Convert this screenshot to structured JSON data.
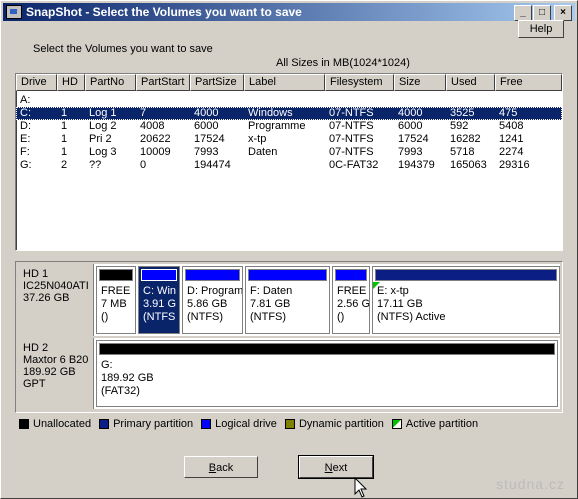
{
  "window": {
    "title": "SnapShot - Select the Volumes you want to save"
  },
  "toolbar": {
    "help_label": "Help"
  },
  "main": {
    "instruction": "Select the Volumes you want to save",
    "sizes_note": "All Sizes in MB(1024*1024)"
  },
  "table": {
    "columns": [
      "Drive",
      "HD",
      "PartNo",
      "PartStart",
      "PartSize",
      "Label",
      "Filesystem",
      "Size",
      "Used",
      "Free"
    ],
    "rows": [
      [
        "A:",
        "",
        "",
        "",
        "",
        "",
        "",
        "",
        "",
        ""
      ],
      [
        "C:",
        "1",
        "Log 1",
        "7",
        "4000",
        "Windows",
        "07-NTFS",
        "4000",
        "3525",
        "475"
      ],
      [
        "D:",
        "1",
        "Log 2",
        "4008",
        "6000",
        "Programme",
        "07-NTFS",
        "6000",
        "592",
        "5408"
      ],
      [
        "E:",
        "1",
        "Pri 2",
        "20622",
        "17524",
        "x-tp",
        "07-NTFS",
        "17524",
        "16282",
        "1241"
      ],
      [
        "F:",
        "1",
        "Log 3",
        "10009",
        "7993",
        "Daten",
        "07-NTFS",
        "7993",
        "5718",
        "2274"
      ],
      [
        "G:",
        "2",
        "??",
        "0",
        "194474",
        "",
        "0C-FAT32",
        "194379",
        "165063",
        "29316"
      ]
    ],
    "selected_row": 1
  },
  "disks": [
    {
      "info": [
        "HD 1",
        "IC25N040ATI",
        "37.26 GB"
      ],
      "partitions": [
        {
          "lines": [
            "FREE",
            "7 MB",
            "()"
          ],
          "bar": "#000000",
          "selected": false
        },
        {
          "lines": [
            "C: Win",
            "3.91 G",
            "(NTFS"
          ],
          "bar": "#0000ff",
          "selected": true
        },
        {
          "lines": [
            "D: Program",
            "5.86 GB",
            "(NTFS)"
          ],
          "bar": "#0000ff",
          "selected": false
        },
        {
          "lines": [
            "F: Daten",
            "7.81 GB",
            "(NTFS)"
          ],
          "bar": "#0000ff",
          "selected": false
        },
        {
          "lines": [
            "FREE",
            "2.56 G",
            "()"
          ],
          "bar": "#0000ff",
          "selected": false
        },
        {
          "lines": [
            "E: x-tp",
            "17.11 GB",
            "(NTFS) Active"
          ],
          "bar": "#0a1e84",
          "selected": false,
          "active": true
        }
      ]
    },
    {
      "info": [
        "HD 2",
        "Maxtor 6 B20",
        "189.92 GB",
        "GPT"
      ],
      "partitions": [
        {
          "lines": [
            "G:",
            "189.92 GB",
            "(FAT32)"
          ],
          "bar": "#000000",
          "selected": false
        }
      ]
    }
  ],
  "legend": [
    {
      "label": "Unallocated",
      "color": "#000000"
    },
    {
      "label": "Primary partition",
      "color": "#0a1e84"
    },
    {
      "label": "Logical drive",
      "color": "#0000ff"
    },
    {
      "label": "Dynamic partition",
      "color": "#808000"
    },
    {
      "label": "Active partition",
      "color": "#00c000"
    }
  ],
  "buttons": {
    "back_prefix": "",
    "back_u": "B",
    "back_rest": "ack",
    "next_prefix": "",
    "next_u": "N",
    "next_rest": "ext"
  },
  "watermark": "studna.cz"
}
